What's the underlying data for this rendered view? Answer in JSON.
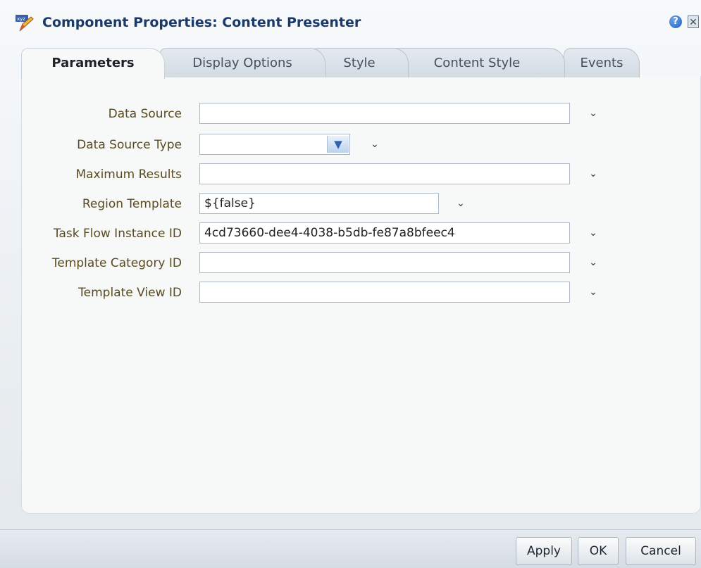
{
  "dialog": {
    "title": "Component Properties: Content Presenter",
    "help_symbol": "?",
    "close_symbol": "✕"
  },
  "tabs": [
    {
      "label": "Parameters",
      "active": true
    },
    {
      "label": "Display Options",
      "active": false
    },
    {
      "label": "Style",
      "active": false
    },
    {
      "label": "Content Style",
      "active": false
    },
    {
      "label": "Events",
      "active": false
    }
  ],
  "fields": [
    {
      "label": "Data Source",
      "value": "",
      "type": "text"
    },
    {
      "label": "Data Source Type",
      "value": "",
      "type": "select"
    },
    {
      "label": "Maximum Results",
      "value": "",
      "type": "text"
    },
    {
      "label": "Region Template",
      "value": "${false}",
      "type": "text"
    },
    {
      "label": "Task Flow Instance ID",
      "value": "4cd73660-dee4-4038-b5db-fe87a8bfeec4",
      "type": "text"
    },
    {
      "label": "Template Category ID",
      "value": "",
      "type": "text"
    },
    {
      "label": "Template View ID",
      "value": "",
      "type": "text"
    }
  ],
  "chevron_symbol": "⌄",
  "footer": {
    "apply_label": "Apply",
    "ok_label": "OK",
    "cancel_label": "Cancel"
  }
}
